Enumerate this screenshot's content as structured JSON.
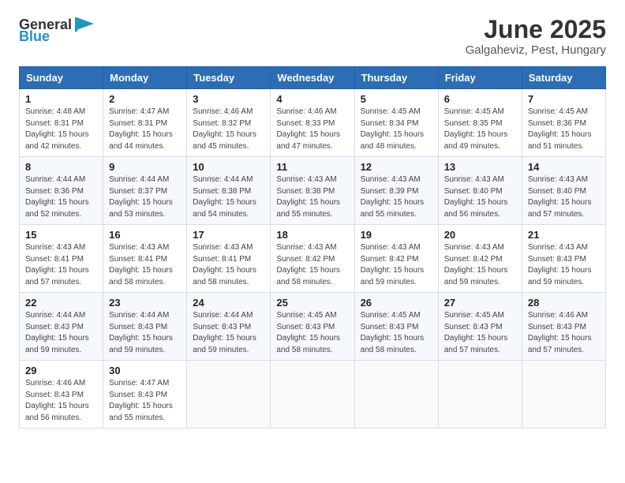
{
  "header": {
    "logo_general": "General",
    "logo_blue": "Blue",
    "month_title": "June 2025",
    "location": "Galgaheviz, Pest, Hungary"
  },
  "days_of_week": [
    "Sunday",
    "Monday",
    "Tuesday",
    "Wednesday",
    "Thursday",
    "Friday",
    "Saturday"
  ],
  "weeks": [
    [
      {
        "day": 1,
        "info": "Sunrise: 4:48 AM\nSunset: 8:31 PM\nDaylight: 15 hours and 42 minutes."
      },
      {
        "day": 2,
        "info": "Sunrise: 4:47 AM\nSunset: 8:31 PM\nDaylight: 15 hours and 44 minutes."
      },
      {
        "day": 3,
        "info": "Sunrise: 4:46 AM\nSunset: 8:32 PM\nDaylight: 15 hours and 45 minutes."
      },
      {
        "day": 4,
        "info": "Sunrise: 4:46 AM\nSunset: 8:33 PM\nDaylight: 15 hours and 47 minutes."
      },
      {
        "day": 5,
        "info": "Sunrise: 4:45 AM\nSunset: 8:34 PM\nDaylight: 15 hours and 48 minutes."
      },
      {
        "day": 6,
        "info": "Sunrise: 4:45 AM\nSunset: 8:35 PM\nDaylight: 15 hours and 49 minutes."
      },
      {
        "day": 7,
        "info": "Sunrise: 4:45 AM\nSunset: 8:36 PM\nDaylight: 15 hours and 51 minutes."
      }
    ],
    [
      {
        "day": 8,
        "info": "Sunrise: 4:44 AM\nSunset: 8:36 PM\nDaylight: 15 hours and 52 minutes."
      },
      {
        "day": 9,
        "info": "Sunrise: 4:44 AM\nSunset: 8:37 PM\nDaylight: 15 hours and 53 minutes."
      },
      {
        "day": 10,
        "info": "Sunrise: 4:44 AM\nSunset: 8:38 PM\nDaylight: 15 hours and 54 minutes."
      },
      {
        "day": 11,
        "info": "Sunrise: 4:43 AM\nSunset: 8:38 PM\nDaylight: 15 hours and 55 minutes."
      },
      {
        "day": 12,
        "info": "Sunrise: 4:43 AM\nSunset: 8:39 PM\nDaylight: 15 hours and 55 minutes."
      },
      {
        "day": 13,
        "info": "Sunrise: 4:43 AM\nSunset: 8:40 PM\nDaylight: 15 hours and 56 minutes."
      },
      {
        "day": 14,
        "info": "Sunrise: 4:43 AM\nSunset: 8:40 PM\nDaylight: 15 hours and 57 minutes."
      }
    ],
    [
      {
        "day": 15,
        "info": "Sunrise: 4:43 AM\nSunset: 8:41 PM\nDaylight: 15 hours and 57 minutes."
      },
      {
        "day": 16,
        "info": "Sunrise: 4:43 AM\nSunset: 8:41 PM\nDaylight: 15 hours and 58 minutes."
      },
      {
        "day": 17,
        "info": "Sunrise: 4:43 AM\nSunset: 8:41 PM\nDaylight: 15 hours and 58 minutes."
      },
      {
        "day": 18,
        "info": "Sunrise: 4:43 AM\nSunset: 8:42 PM\nDaylight: 15 hours and 58 minutes."
      },
      {
        "day": 19,
        "info": "Sunrise: 4:43 AM\nSunset: 8:42 PM\nDaylight: 15 hours and 59 minutes."
      },
      {
        "day": 20,
        "info": "Sunrise: 4:43 AM\nSunset: 8:42 PM\nDaylight: 15 hours and 59 minutes."
      },
      {
        "day": 21,
        "info": "Sunrise: 4:43 AM\nSunset: 8:43 PM\nDaylight: 15 hours and 59 minutes."
      }
    ],
    [
      {
        "day": 22,
        "info": "Sunrise: 4:44 AM\nSunset: 8:43 PM\nDaylight: 15 hours and 59 minutes."
      },
      {
        "day": 23,
        "info": "Sunrise: 4:44 AM\nSunset: 8:43 PM\nDaylight: 15 hours and 59 minutes."
      },
      {
        "day": 24,
        "info": "Sunrise: 4:44 AM\nSunset: 8:43 PM\nDaylight: 15 hours and 59 minutes."
      },
      {
        "day": 25,
        "info": "Sunrise: 4:45 AM\nSunset: 8:43 PM\nDaylight: 15 hours and 58 minutes."
      },
      {
        "day": 26,
        "info": "Sunrise: 4:45 AM\nSunset: 8:43 PM\nDaylight: 15 hours and 58 minutes."
      },
      {
        "day": 27,
        "info": "Sunrise: 4:45 AM\nSunset: 8:43 PM\nDaylight: 15 hours and 57 minutes."
      },
      {
        "day": 28,
        "info": "Sunrise: 4:46 AM\nSunset: 8:43 PM\nDaylight: 15 hours and 57 minutes."
      }
    ],
    [
      {
        "day": 29,
        "info": "Sunrise: 4:46 AM\nSunset: 8:43 PM\nDaylight: 15 hours and 56 minutes."
      },
      {
        "day": 30,
        "info": "Sunrise: 4:47 AM\nSunset: 8:43 PM\nDaylight: 15 hours and 55 minutes."
      },
      null,
      null,
      null,
      null,
      null
    ]
  ]
}
